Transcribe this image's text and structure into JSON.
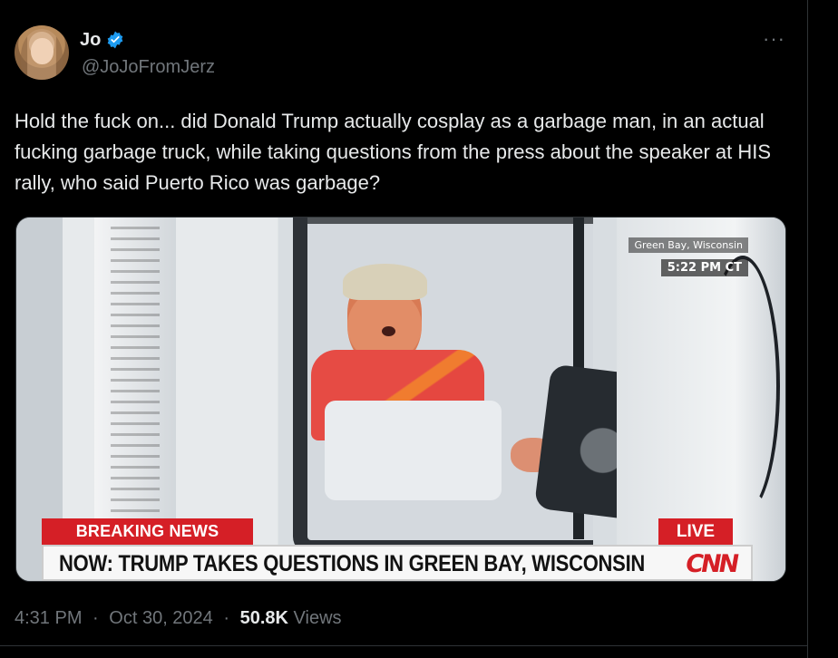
{
  "author": {
    "display_name": "Jo",
    "handle": "@JoJoFromJerz",
    "verified_icon": "verified-badge-icon",
    "avatar_icon": "avatar"
  },
  "post": {
    "text": "Hold the fuck on... did Donald Trump actually cosplay as a garbage man, in an actual fucking garbage truck, while taking questions from the press about the speaker at HIS rally, who said Puerto Rico was garbage?",
    "more_label": "···"
  },
  "media": {
    "location": "Green Bay, Wisconsin",
    "time": "5:22 PM CT",
    "breaking": "BREAKING NEWS",
    "live": "LIVE",
    "headline": "NOW: TRUMP TAKES QUESTIONS IN GREEN BAY, WISCONSIN",
    "network": "CNN"
  },
  "meta": {
    "time": "4:31 PM",
    "date": "Oct 30, 2024",
    "views_count": "50.8K",
    "views_label": "Views",
    "separator": "·"
  },
  "colors": {
    "background": "#000000",
    "text": "#e7e9ea",
    "muted": "#71767b",
    "verified": "#1d9bf0",
    "breaking_red": "#d51f26"
  }
}
